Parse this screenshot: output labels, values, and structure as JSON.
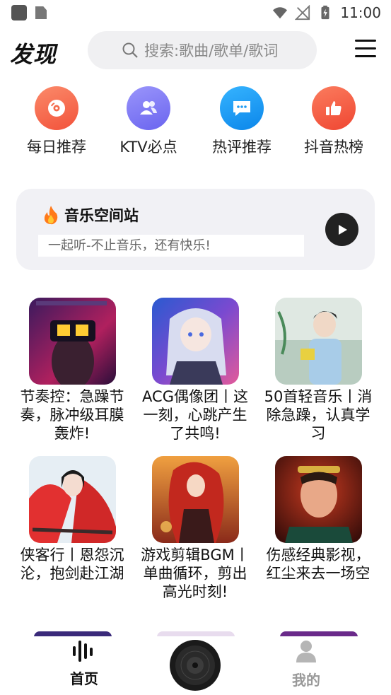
{
  "status_bar": {
    "time": "11:00"
  },
  "header": {
    "title": "发现",
    "search_placeholder": "搜索:歌曲/歌单/歌词"
  },
  "quick_nav": [
    {
      "label": "每日推荐",
      "icon": "disc-icon",
      "color": "#f46a4b"
    },
    {
      "label": "KTV必点",
      "icon": "users-icon",
      "color": "#7b77f5"
    },
    {
      "label": "热评推荐",
      "icon": "comment-icon",
      "color": "#1f9cf3"
    },
    {
      "label": "抖音热榜",
      "icon": "thumbs-up-icon",
      "color": "#f25a45"
    }
  ],
  "station": {
    "title": "音乐空间站",
    "subtitle": "一起听-不止音乐，还有快乐!"
  },
  "playlists": [
    {
      "title": "节奏控：急躁节奏，脉冲级耳膜轰炸!"
    },
    {
      "title": "ACG偶像团丨这一刻，心跳产生了共鸣!"
    },
    {
      "title": "50首轻音乐丨消除急躁，认真学习"
    },
    {
      "title": "侠客行丨恩怨沉沦，抱剑赴江湖"
    },
    {
      "title": "游戏剪辑BGM丨单曲循环，剪出高光时刻!"
    },
    {
      "title": "伤感经典影视，红尘来去一场空"
    }
  ],
  "bottom_nav": {
    "home_label": "首页",
    "mine_label": "我的"
  }
}
